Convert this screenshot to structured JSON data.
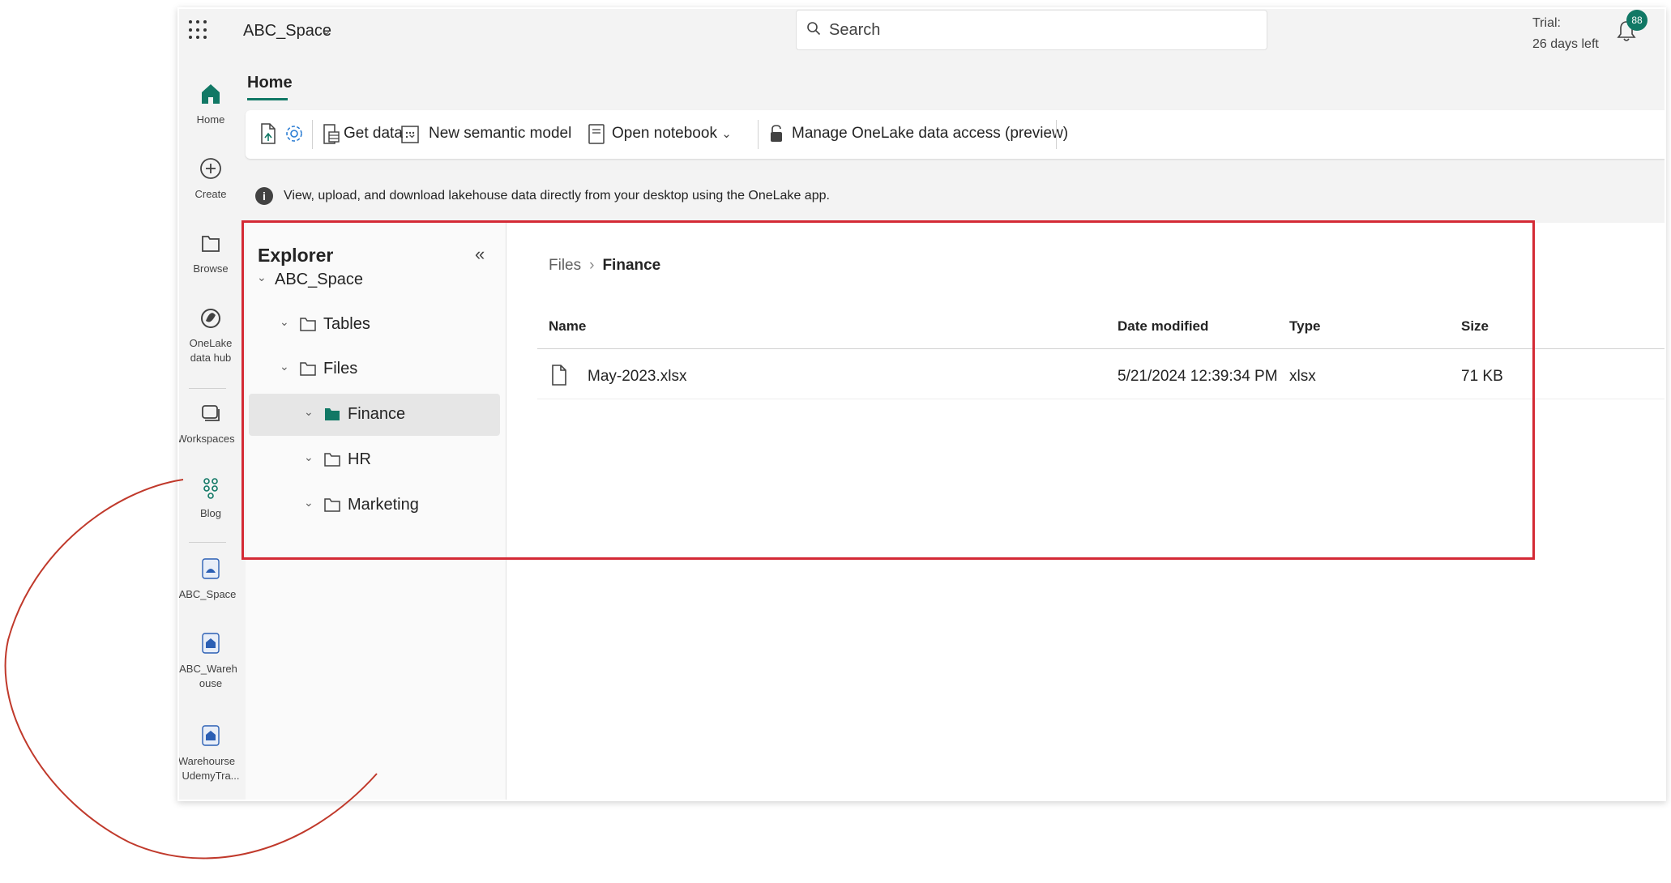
{
  "topbar": {
    "workspace_name": "ABC_Space",
    "search_placeholder": "Search",
    "trial_line1": "Trial:",
    "trial_line2": "26 days left",
    "notification_count": "88"
  },
  "rail": {
    "items": [
      {
        "label": "Home",
        "icon": "home-icon"
      },
      {
        "label": "Create",
        "icon": "create-icon"
      },
      {
        "label": "Browse",
        "icon": "browse-icon"
      },
      {
        "label": "OneLake",
        "label2": "data hub",
        "icon": "onelake-icon"
      },
      {
        "label": "Workspaces",
        "icon": "workspaces-icon"
      },
      {
        "label": "Blog",
        "icon": "blog-icon"
      },
      {
        "label": "ABC_Space",
        "icon": "lakehouse-icon"
      },
      {
        "label": "ABC_Wareh",
        "label2": "ouse",
        "icon": "warehouse-icon"
      },
      {
        "label": "Warehourse",
        "label2": "UdemyTra...",
        "icon": "warehouse-icon"
      }
    ]
  },
  "ribbon": {
    "tab": "Home",
    "get_data": "Get data",
    "new_semantic_model": "New semantic model",
    "open_notebook": "Open notebook",
    "manage_access": "Manage OneLake data access (preview)"
  },
  "info": {
    "message": "View, upload, and download lakehouse data directly from your desktop using the OneLake app."
  },
  "explorer": {
    "title": "Explorer",
    "tree": [
      {
        "label": "ABC_Space",
        "level": 0,
        "type": "root"
      },
      {
        "label": "Tables",
        "level": 1,
        "type": "folder"
      },
      {
        "label": "Files",
        "level": 1,
        "type": "folder"
      },
      {
        "label": "Finance",
        "level": 2,
        "type": "folder",
        "selected": true
      },
      {
        "label": "HR",
        "level": 2,
        "type": "folder"
      },
      {
        "label": "Marketing",
        "level": 2,
        "type": "folder"
      }
    ]
  },
  "breadcrumb": {
    "root": "Files",
    "current": "Finance"
  },
  "table": {
    "columns": [
      "Name",
      "Date modified",
      "Type",
      "Size"
    ],
    "rows": [
      {
        "name": "May-2023.xlsx",
        "date": "5/21/2024 12:39:34 PM",
        "type": "xlsx",
        "size": "71 KB"
      }
    ]
  },
  "colors": {
    "accent": "#117865",
    "highlight_box": "#d42a35",
    "annotation_circle": "#c0392b"
  }
}
